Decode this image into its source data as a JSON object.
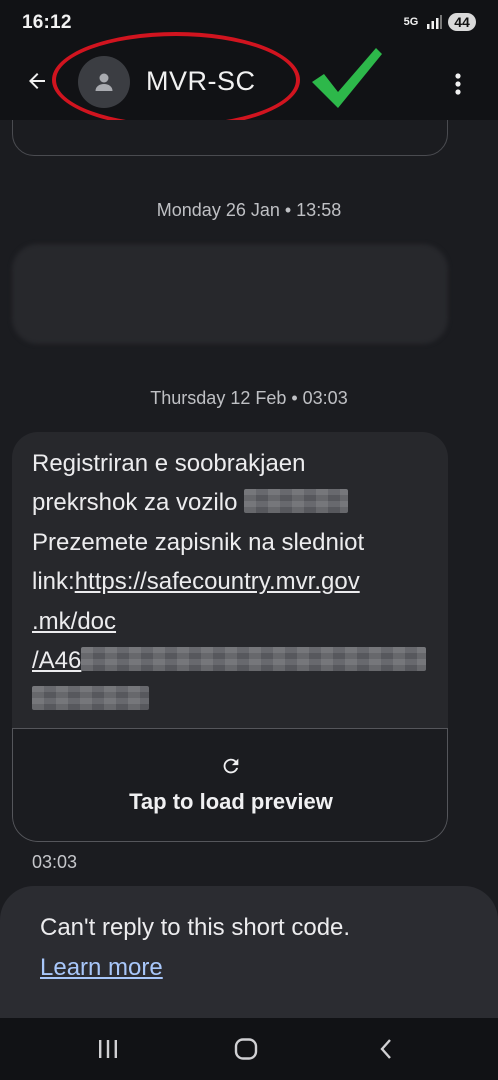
{
  "status_bar": {
    "time": "16:12",
    "network": "5G",
    "battery": "44"
  },
  "header": {
    "contact_name": "MVR-SC",
    "icons": [
      "back-arrow-icon",
      "person-icon",
      "more-vert-icon",
      "checkmark-icon"
    ],
    "annotation_colors": {
      "ellipse": "#d1141f",
      "checkmark": "#2db84a"
    }
  },
  "conversation": {
    "date_separator_1": "Monday 26 Jan • 13:58",
    "date_separator_2": "Thursday 12 Feb • 03:03",
    "message": {
      "line1": "Registriran e soobrakjaen",
      "line2_text": "prekrshok za vozilo ",
      "line3": "Prezemete zapisnik na sledniot",
      "line4_text": "link:",
      "line4_link": "https://safecountry.mvr.gov",
      "line5_link": ".mk/doc",
      "line6_link": "/A46",
      "preview_label": "Tap to load preview",
      "time": "03:03"
    }
  },
  "reply_area": {
    "notice": "Can't reply to this short code.",
    "learn_more": "Learn more"
  },
  "colors": {
    "background": "#1b1c20",
    "bubble": "#27282c",
    "link_accent": "#a8c7fa"
  }
}
